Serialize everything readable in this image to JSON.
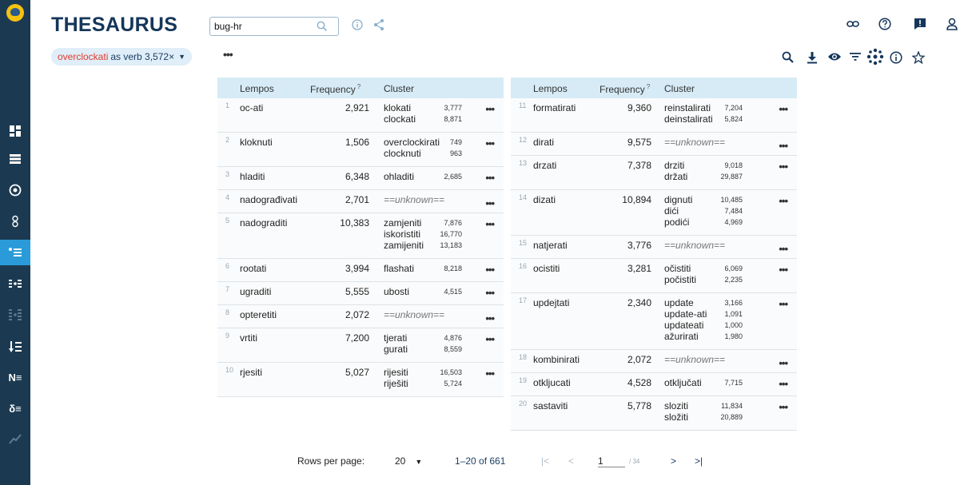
{
  "app": {
    "title": "THESAURUS"
  },
  "search": {
    "value": "bug-hr",
    "placeholder": ""
  },
  "filter": {
    "word": "overclockati",
    "rest": "as verb 3,572×"
  },
  "columns": {
    "lempos": "Lempos",
    "frequency": "Frequency",
    "frequency_sup": "?",
    "cluster": "Cluster"
  },
  "left_rows": [
    {
      "n": "1",
      "lemma": "oc-ati",
      "freq": "2,921",
      "clusters": [
        {
          "w": "klokati",
          "f": "3,777"
        },
        {
          "w": "clockati",
          "f": "8,871"
        }
      ]
    },
    {
      "n": "2",
      "lemma": "kloknuti",
      "freq": "1,506",
      "clusters": [
        {
          "w": "overclockirati",
          "f": "749"
        },
        {
          "w": "clocknuti",
          "f": "963"
        }
      ]
    },
    {
      "n": "3",
      "lemma": "hladiti",
      "freq": "6,348",
      "clusters": [
        {
          "w": "ohladiti",
          "f": "2,685"
        }
      ]
    },
    {
      "n": "4",
      "lemma": "nadograđivati",
      "freq": "2,701",
      "unknown": "==unknown=="
    },
    {
      "n": "5",
      "lemma": "nadograditi",
      "freq": "10,383",
      "clusters": [
        {
          "w": "zamjeniti",
          "f": "7,876"
        },
        {
          "w": "iskoristiti",
          "f": "16,770"
        },
        {
          "w": "zamijeniti",
          "f": "13,183"
        }
      ]
    },
    {
      "n": "6",
      "lemma": "rootati",
      "freq": "3,994",
      "clusters": [
        {
          "w": "flashati",
          "f": "8,218"
        }
      ]
    },
    {
      "n": "7",
      "lemma": "ugraditi",
      "freq": "5,555",
      "clusters": [
        {
          "w": "ubosti",
          "f": "4,515"
        }
      ]
    },
    {
      "n": "8",
      "lemma": "opteretiti",
      "freq": "2,072",
      "unknown": "==unknown=="
    },
    {
      "n": "9",
      "lemma": "vrtiti",
      "freq": "7,200",
      "clusters": [
        {
          "w": "tjerati",
          "f": "4,876"
        },
        {
          "w": "gurati",
          "f": "8,559"
        }
      ]
    },
    {
      "n": "10",
      "lemma": "rjesiti",
      "freq": "5,027",
      "clusters": [
        {
          "w": "rijesiti",
          "f": "16,503"
        },
        {
          "w": "riješiti",
          "f": "5,724"
        }
      ]
    }
  ],
  "right_rows": [
    {
      "n": "11",
      "lemma": "formatirati",
      "freq": "9,360",
      "clusters": [
        {
          "w": "reinstalirati",
          "f": "7,204"
        },
        {
          "w": "deinstalirati",
          "f": "5,824"
        }
      ]
    },
    {
      "n": "12",
      "lemma": "dirati",
      "freq": "9,575",
      "unknown": "==unknown=="
    },
    {
      "n": "13",
      "lemma": "drzati",
      "freq": "7,378",
      "clusters": [
        {
          "w": "drziti",
          "f": "9,018"
        },
        {
          "w": "držati",
          "f": "29,887"
        }
      ]
    },
    {
      "n": "14",
      "lemma": "dizati",
      "freq": "10,894",
      "clusters": [
        {
          "w": "dignuti",
          "f": "10,485"
        },
        {
          "w": "dići",
          "f": "7,484"
        },
        {
          "w": "podići",
          "f": "4,969"
        }
      ]
    },
    {
      "n": "15",
      "lemma": "natjerati",
      "freq": "3,776",
      "unknown": "==unknown=="
    },
    {
      "n": "16",
      "lemma": "ocistiti",
      "freq": "3,281",
      "clusters": [
        {
          "w": "očistiti",
          "f": "6,069"
        },
        {
          "w": "počistiti",
          "f": "2,235"
        }
      ]
    },
    {
      "n": "17",
      "lemma": "updejtati",
      "freq": "2,340",
      "clusters": [
        {
          "w": "update",
          "f": "3,166"
        },
        {
          "w": "update-ati",
          "f": "1,091"
        },
        {
          "w": "updateati",
          "f": "1,000"
        },
        {
          "w": "ažurirati",
          "f": "1,980"
        }
      ]
    },
    {
      "n": "18",
      "lemma": "kombinirati",
      "freq": "2,072",
      "unknown": "==unknown=="
    },
    {
      "n": "19",
      "lemma": "otkljucati",
      "freq": "4,528",
      "clusters": [
        {
          "w": "otključati",
          "f": "7,715"
        }
      ]
    },
    {
      "n": "20",
      "lemma": "sastaviti",
      "freq": "5,778",
      "clusters": [
        {
          "w": "sloziti",
          "f": "11,834"
        },
        {
          "w": "složiti",
          "f": "20,889"
        }
      ]
    }
  ],
  "pagination": {
    "rows_label": "Rows per page:",
    "rows_value": "20",
    "range": "1–20 of 661",
    "page": "1",
    "total_pages": "/ 34"
  },
  "sidebar": {
    "items": [
      "dashboard-icon",
      "list-icon",
      "circle-dot-icon",
      "rings-icon",
      "thesaurus-icon",
      "compare-icon",
      "compare-multi-icon",
      "sort-icon",
      "ngram-icon",
      "sketch-diff-icon",
      "trends-icon"
    ],
    "mixed_label": "N≡",
    "diff_label": "δ≡"
  },
  "colors": {
    "accent": "#2a9bd8",
    "sidebar": "#1b3a52",
    "header_bg": "#d6ebf6",
    "highlight": "#e23a2e"
  }
}
